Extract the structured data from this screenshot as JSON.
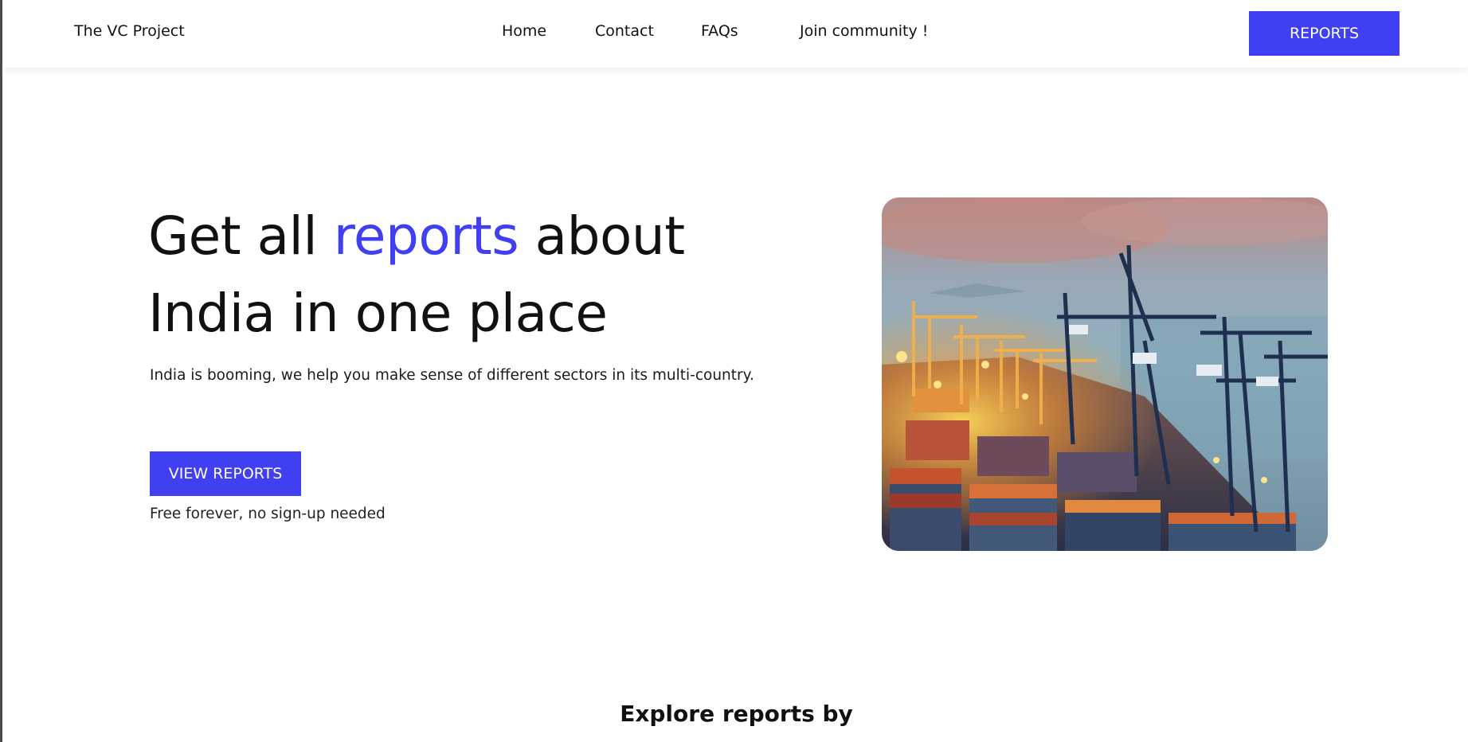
{
  "header": {
    "brand": "The VC Project",
    "nav": {
      "home": "Home",
      "contact": "Contact",
      "faqs": "FAQs",
      "join": "Join community !"
    },
    "cta": "REPORTS"
  },
  "hero": {
    "title_part1": "Get all ",
    "title_accent": "reports",
    "title_part2": " about",
    "title_line2": "India in one place",
    "subtitle": "India is booming, we help you make sense of different sectors in its multi-country.",
    "button": "VIEW REPORTS",
    "note": "Free forever, no sign-up needed",
    "image_icon": "port-cranes-image"
  },
  "section": {
    "title": "Explore reports by"
  },
  "colors": {
    "accent": "#4040f2",
    "text": "#111111",
    "background": "#ffffff"
  }
}
